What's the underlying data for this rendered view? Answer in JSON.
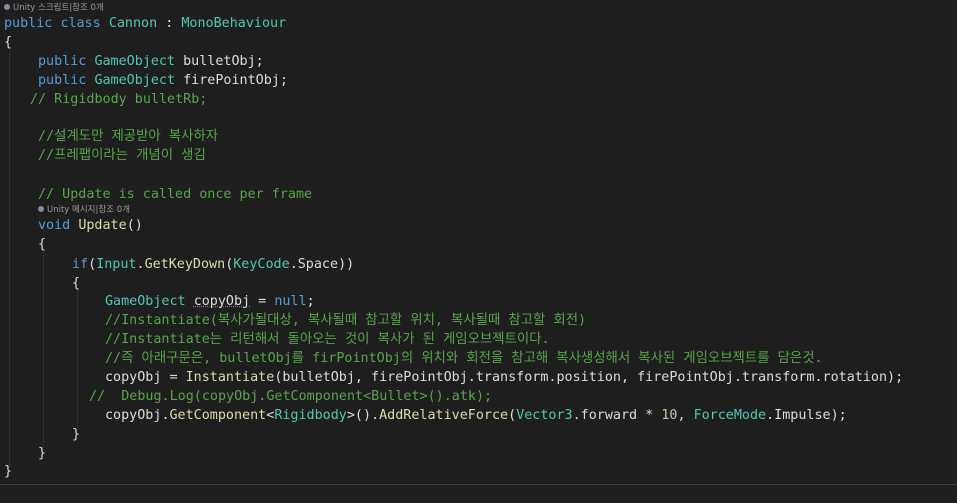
{
  "codelens": {
    "class_hint": "Unity 스크립트|참조 0개",
    "method_hint": "Unity 메시지|참조 0개"
  },
  "code": {
    "l1": {
      "kw1": "public",
      "kw2": "class",
      "name": "Cannon",
      "sep": " : ",
      "base": "MonoBehaviour"
    },
    "l2": "{",
    "l3": {
      "kw": "public",
      "type": "GameObject",
      "name": "bulletObj;"
    },
    "l4": {
      "kw": "public",
      "type": "GameObject",
      "name": "firePointObj;"
    },
    "l5": "// Rigidbody bulletRb;",
    "l6": "//설계도만 제공받아 복사하자",
    "l7": "//프레팹이라는 개념이 생김",
    "l8": "// Update is called once per frame",
    "l9": {
      "kw": "void",
      "name": "Update",
      "rest": "()"
    },
    "l10": "{",
    "l11": {
      "kw": "if",
      "p1": "(",
      "t1": "Input",
      "dot1": ".",
      "m1": "GetKeyDown",
      "p2": "(",
      "t2": "KeyCode",
      "dot2": ".",
      "v": "Space",
      "p3": "))"
    },
    "l12": "{",
    "l13": {
      "type": "GameObject",
      "name": "copyObj",
      "eq": " = ",
      "val": "null",
      "end": ";"
    },
    "l14": "//Instantiate(복사가될대상, 복사될때 참고할 위치, 복사될때 참고할 회전)",
    "l15": "//Instantiate는 리턴해서 돌아오는 것이 복사가 된 게임오브젝트이다.",
    "l16": "//즉 아래구문은, bulletObj를 firPointObj의 위치와 회전을 참고해 복사생성해서 복사된 게임오브젝트를 담은것.",
    "l17": {
      "a": "copyObj",
      "b": " = ",
      "fn": "Instantiate",
      "c": "(bulletObj, firePointObj.transform.position, firePointObj.transform.rotation);"
    },
    "l18": "//  Debug.Log(copyObj.GetComponent<Bullet>().atk);",
    "l19": {
      "a": "copyObj",
      "b": ".",
      "fn": "GetComponent",
      "c": "<",
      "t": "Rigidbody",
      "d": ">().",
      "fn2": "AddRelativeForce",
      "e": "(",
      "t2": "Vector3",
      "f": ".forward * ",
      "num": "10",
      "g": ", ",
      "t3": "ForceMode",
      "h": ".Impulse);"
    },
    "l20": "}",
    "l21": "}",
    "l22": "}"
  }
}
